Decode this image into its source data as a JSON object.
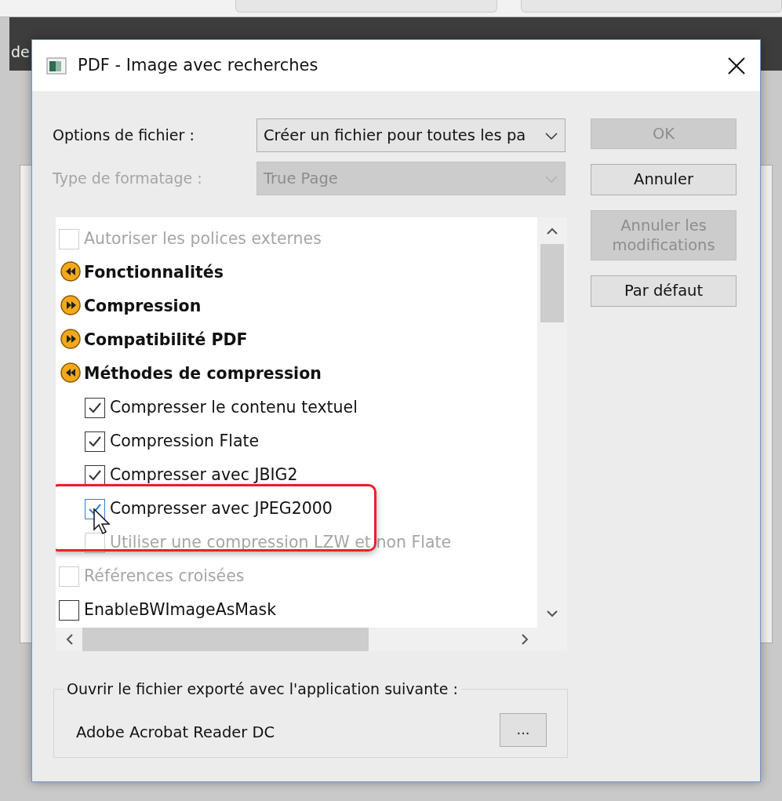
{
  "background": {
    "text": "de"
  },
  "window": {
    "title": "PDF - Image avec recherches"
  },
  "fields": [
    {
      "label": "Options de fichier :",
      "value": "Créer un fichier pour toutes les pa",
      "disabled": false
    },
    {
      "label": "Type de formatage :",
      "value": "True Page",
      "disabled": true
    }
  ],
  "buttons": [
    {
      "label": "OK",
      "disabled": true
    },
    {
      "label": "Annuler",
      "disabled": false
    },
    {
      "label": "Annuler les modifications",
      "disabled": true
    },
    {
      "label": "Par défaut",
      "disabled": false
    }
  ],
  "options": [
    {
      "kind": "checkbox",
      "label": "Autoriser les polices externes",
      "checked": false,
      "disabled": true,
      "hovered": false,
      "highlighted": false
    },
    {
      "kind": "group",
      "label": "Fonctionnalités",
      "expanded": true
    },
    {
      "kind": "group",
      "label": "Compression",
      "expanded": false
    },
    {
      "kind": "group",
      "label": "Compatibilité PDF",
      "expanded": false
    },
    {
      "kind": "group",
      "label": "Méthodes de compression",
      "expanded": true,
      "children": [
        {
          "kind": "checkbox",
          "label": "Compresser le contenu textuel",
          "checked": true,
          "disabled": false,
          "hovered": false,
          "highlighted": false
        },
        {
          "kind": "checkbox",
          "label": "Compression Flate",
          "checked": true,
          "disabled": false,
          "hovered": false,
          "highlighted": false
        },
        {
          "kind": "checkbox",
          "label": "Compresser avec JBIG2",
          "checked": true,
          "disabled": false,
          "hovered": false,
          "highlighted": false
        },
        {
          "kind": "checkbox",
          "label": "Compresser avec JPEG2000",
          "checked": true,
          "disabled": false,
          "hovered": true,
          "highlighted": true
        },
        {
          "kind": "checkbox",
          "label": "Utiliser une compression LZW et non Flate",
          "checked": false,
          "disabled": true,
          "hovered": false,
          "highlighted": false
        }
      ]
    },
    {
      "kind": "checkbox",
      "label": "Références croisées",
      "checked": false,
      "disabled": true,
      "hovered": false,
      "highlighted": false
    },
    {
      "kind": "checkbox",
      "label": "EnableBWImageAsMask",
      "checked": false,
      "disabled": false,
      "hovered": false,
      "highlighted": false
    }
  ],
  "open_with": {
    "legend": "Ouvrir le fichier exporté avec l'application suivante :",
    "application": "Adobe Acrobat Reader DC",
    "browse_button": "..."
  }
}
